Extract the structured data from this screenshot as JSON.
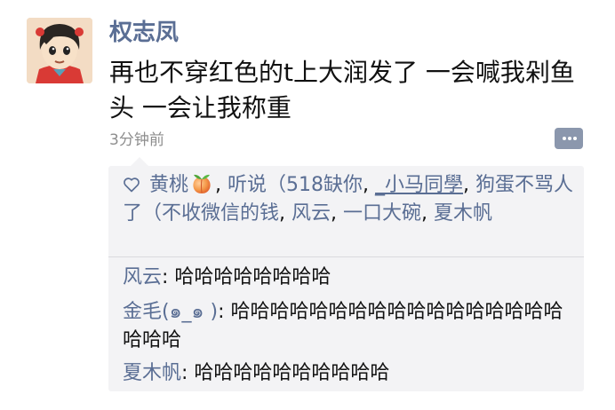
{
  "post": {
    "author": "权志凤",
    "text": "再也不穿红色的t上大润发了 一会喊我剁鱼头 一会让我称重",
    "timestamp": "3分钟前",
    "avatar_icon": "avatar-cartoon-girl-icon"
  },
  "comment_button": {
    "icon": "comment-dots-icon"
  },
  "likes": {
    "icon": "heart-outline-icon",
    "users": [
      {
        "name": "黄桃",
        "emoji_icon": "peach-emoji-icon"
      },
      {
        "name": "听说（518缺你"
      },
      {
        "name": "_小马同學"
      },
      {
        "name": "狗蛋不骂人了（不收微信的钱"
      },
      {
        "name": "风云"
      },
      {
        "name": "一口大碗"
      },
      {
        "name": "夏木帆"
      }
    ],
    "separator": ", "
  },
  "comments": [
    {
      "author": "风云",
      "separator": ": ",
      "text": "哈哈哈哈哈哈哈哈"
    },
    {
      "author": "金毛(๑_๑ )",
      "separator": ": ",
      "text": "哈哈哈哈哈哈哈哈哈哈哈哈哈哈哈哈哈哈哈哈"
    },
    {
      "author": "夏木帆",
      "separator": ": ",
      "text": "哈哈哈哈哈哈哈哈哈哈"
    }
  ],
  "colors": {
    "name_link": "#5a6e94",
    "box_background": "#f3f3f5",
    "timestamp": "#8e8e8e",
    "comment_button": "#8b97ad"
  }
}
